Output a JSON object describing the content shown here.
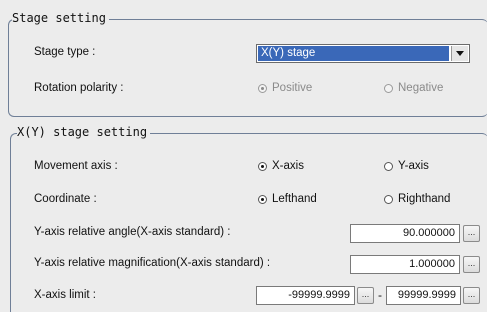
{
  "stage_setting": {
    "title": "Stage setting",
    "stage_type_label": "Stage type :",
    "stage_type_value": "X(Y) stage",
    "rotation_label": "Rotation polarity :",
    "rotation_positive": "Positive",
    "rotation_negative": "Negative",
    "rotation_selected": "Positive"
  },
  "xy_stage_setting": {
    "title": "X(Y) stage setting",
    "movement_label": "Movement axis :",
    "movement_x": "X-axis",
    "movement_y": "Y-axis",
    "movement_selected": "X-axis",
    "coordinate_label": "Coordinate :",
    "coordinate_left": "Lefthand",
    "coordinate_right": "Righthand",
    "coordinate_selected": "Lefthand",
    "y_angle_label": "Y-axis relative angle(X-axis standard) :",
    "y_angle_value": "90.000000",
    "y_mag_label": "Y-axis relative magnification(X-axis standard) :",
    "y_mag_value": "1.000000",
    "x_limit_label": "X-axis limit :",
    "x_limit_min": "-99999.9999",
    "x_limit_dash": "-",
    "x_limit_max": "99999.9999",
    "ellipsis": "..."
  }
}
